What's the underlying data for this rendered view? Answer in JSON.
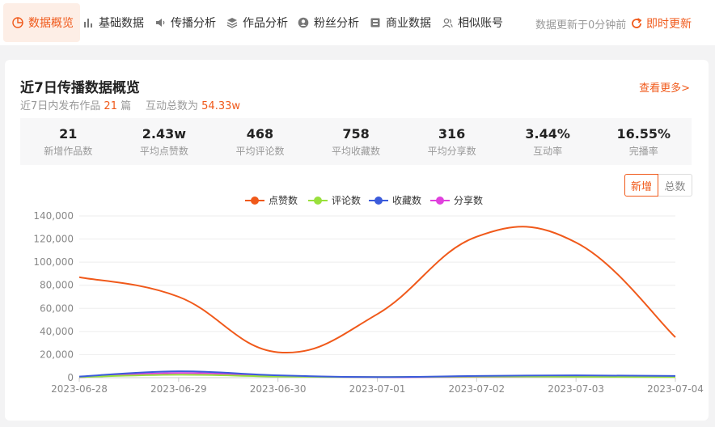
{
  "topbar": {
    "tabs": [
      {
        "label": "数据概览",
        "icon": "pie-chart-icon",
        "active": true
      },
      {
        "label": "基础数据",
        "icon": "bar-chart-icon",
        "active": false
      },
      {
        "label": "传播分析",
        "icon": "speaker-icon",
        "active": false
      },
      {
        "label": "作品分析",
        "icon": "layers-icon",
        "active": false
      },
      {
        "label": "粉丝分析",
        "icon": "user-circle-icon",
        "active": false
      },
      {
        "label": "商业数据",
        "icon": "store-icon",
        "active": false
      },
      {
        "label": "相似账号",
        "icon": "users-icon",
        "active": false
      }
    ],
    "update_text": "数据更新于0分钟前",
    "refresh_label": "即时更新",
    "accent": "#f0591a"
  },
  "overview": {
    "title": "近7日传播数据概览",
    "sub_prefix": "近7日内发布作品",
    "works_count": "21",
    "works_unit": "篇",
    "interaction_prefix": "互动总数为",
    "interaction_total": "54.33w",
    "see_more": "查看更多>"
  },
  "stats": [
    {
      "value": "21",
      "label": "新增作品数"
    },
    {
      "value": "2.43w",
      "label": "平均点赞数"
    },
    {
      "value": "468",
      "label": "平均评论数"
    },
    {
      "value": "758",
      "label": "平均收藏数"
    },
    {
      "value": "316",
      "label": "平均分享数"
    },
    {
      "value": "3.44%",
      "label": "互动率"
    },
    {
      "value": "16.55%",
      "label": "完播率"
    }
  ],
  "toggle": {
    "new_label": "新增",
    "total_label": "总数",
    "selected": "新增"
  },
  "chart_data": {
    "type": "line",
    "x": [
      "2023-06-28",
      "2023-06-29",
      "2023-06-30",
      "2023-07-01",
      "2023-07-02",
      "2023-07-03",
      "2023-07-04"
    ],
    "ylim": [
      0,
      140000
    ],
    "yticks": [
      "0",
      "20,000",
      "40,000",
      "60,000",
      "80,000",
      "100,000",
      "120,000",
      "140,000"
    ],
    "legend_position": "top-center",
    "grid": true,
    "series": [
      {
        "name": "点赞数",
        "color": "#f0591a",
        "values": [
          87000,
          70000,
          22000,
          55000,
          122000,
          117000,
          35000
        ]
      },
      {
        "name": "评论数",
        "color": "#99e03c",
        "values": [
          500,
          2500,
          1000,
          500,
          1000,
          800,
          500
        ]
      },
      {
        "name": "收藏数",
        "color": "#3b5bdb",
        "values": [
          1000,
          5500,
          2000,
          500,
          1500,
          2000,
          1500
        ]
      },
      {
        "name": "分享数",
        "color": "#e040dd",
        "values": [
          300,
          4000,
          1500,
          400,
          800,
          1000,
          700
        ]
      }
    ]
  }
}
